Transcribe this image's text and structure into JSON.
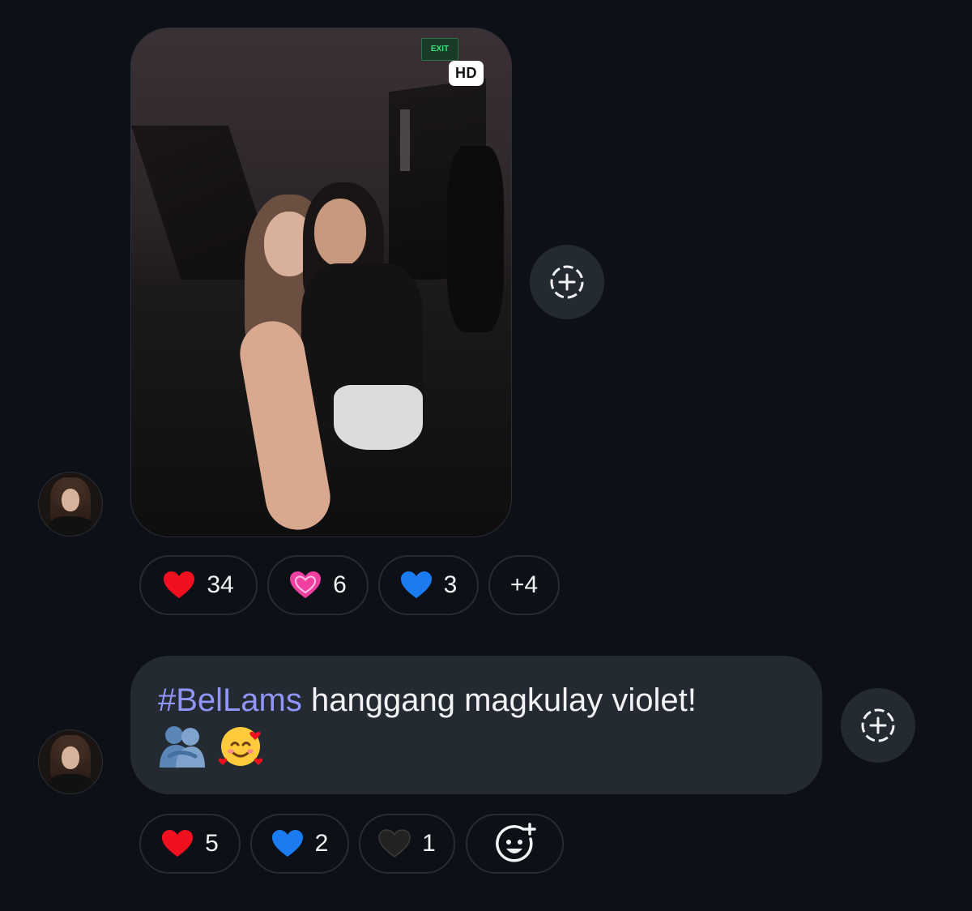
{
  "messages": [
    {
      "type": "photo",
      "badge": "HD",
      "photo_sign_text": "EXIT",
      "reactions": [
        {
          "emoji": "red-heart",
          "count": "34"
        },
        {
          "emoji": "pink-heart",
          "count": "6"
        },
        {
          "emoji": "blue-heart",
          "count": "3"
        }
      ],
      "more_reactions": "+4"
    },
    {
      "type": "text",
      "hashtag": "#BelLams",
      "text": " hanggang magkulay violet!",
      "emojis": [
        "🫂",
        "🥰"
      ],
      "reactions": [
        {
          "emoji": "red-heart",
          "count": "5"
        },
        {
          "emoji": "blue-heart",
          "count": "2"
        },
        {
          "emoji": "black-heart",
          "count": "1"
        }
      ]
    }
  ],
  "colors": {
    "background": "#0d1117",
    "bubble": "#242a32",
    "hashtag": "#8f95f9",
    "red_heart": "#f0101f",
    "pink_heart": "#f03fa0",
    "blue_heart": "#1a7cf0",
    "black_heart": "#222222"
  },
  "icons": {
    "share_action": "dashed-circle-plus-icon",
    "add_reaction": "smiley-plus-icon"
  }
}
